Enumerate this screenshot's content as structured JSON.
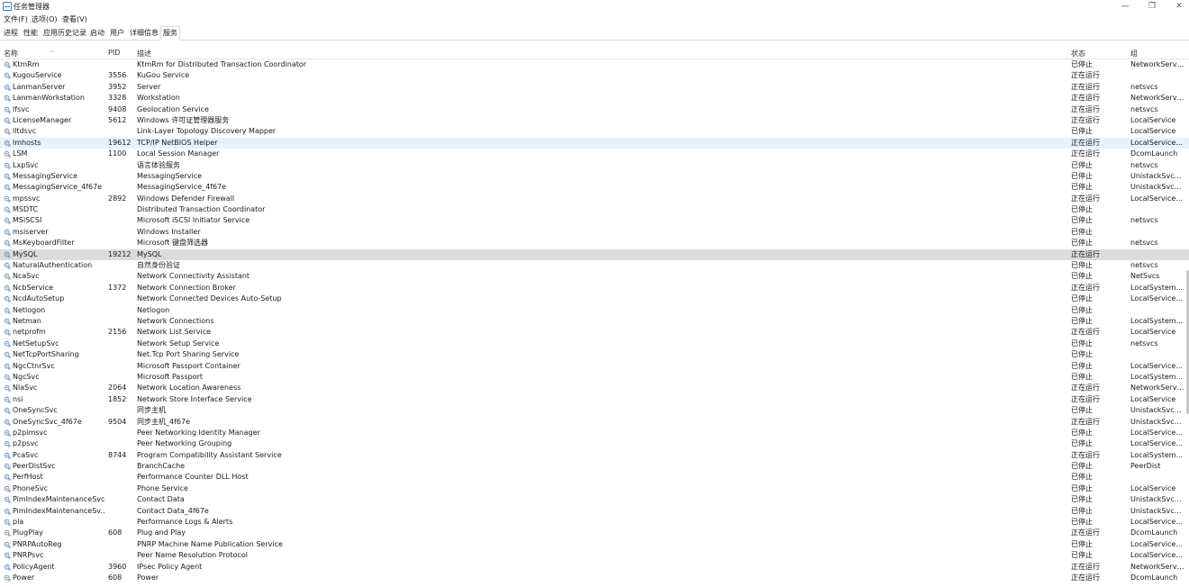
{
  "window": {
    "title": "任务管理器",
    "minimize": "—",
    "restore": "❐",
    "close": "✕"
  },
  "menu": [
    {
      "label": "文件(F)"
    },
    {
      "label": "选项(O)"
    },
    {
      "label": "查看(V)"
    }
  ],
  "tabs": [
    {
      "label": "进程"
    },
    {
      "label": "性能"
    },
    {
      "label": "应用历史记录"
    },
    {
      "label": "启动"
    },
    {
      "label": "用户"
    },
    {
      "label": "详细信息"
    },
    {
      "label": "服务",
      "active": true
    }
  ],
  "columns": {
    "name": "名称",
    "pid": "PID",
    "desc": "描述",
    "status": "状态",
    "group": "组"
  },
  "icons": {
    "service": "gear-service-icon",
    "sort": "sort-up-icon"
  },
  "colors": {
    "selected_row": "#cfe7fb",
    "hover_row": "#dcdcdc"
  },
  "rows": [
    {
      "name": "KtmRm",
      "pid": "",
      "desc": "KtmRm for Distributed Transaction Coordinator",
      "status": "已停止",
      "group": "NetworkServi..."
    },
    {
      "name": "KugouService",
      "pid": "3556",
      "desc": "KuGou Service",
      "status": "正在运行",
      "group": ""
    },
    {
      "name": "LanmanServer",
      "pid": "3952",
      "desc": "Server",
      "status": "正在运行",
      "group": "netsvcs"
    },
    {
      "name": "LanmanWorkstation",
      "pid": "3328",
      "desc": "Workstation",
      "status": "正在运行",
      "group": "NetworkServi..."
    },
    {
      "name": "lfsvc",
      "pid": "9408",
      "desc": "Geolocation Service",
      "status": "正在运行",
      "group": "netsvcs"
    },
    {
      "name": "LicenseManager",
      "pid": "5612",
      "desc": "Windows 许可证管理器服务",
      "status": "正在运行",
      "group": "LocalService"
    },
    {
      "name": "lltdsvc",
      "pid": "",
      "desc": "Link-Layer Topology Discovery Mapper",
      "status": "已停止",
      "group": "LocalService"
    },
    {
      "name": "lmhosts",
      "pid": "19612",
      "desc": "TCP/IP NetBIOS Helper",
      "status": "正在运行",
      "group": "LocalService...",
      "state": "highlight"
    },
    {
      "name": "LSM",
      "pid": "1100",
      "desc": "Local Session Manager",
      "status": "正在运行",
      "group": "DcomLaunch"
    },
    {
      "name": "LxpSvc",
      "pid": "",
      "desc": "语言体验服务",
      "status": "已停止",
      "group": "netsvcs"
    },
    {
      "name": "MessagingService",
      "pid": "",
      "desc": "MessagingService",
      "status": "已停止",
      "group": "UnistackSvcG..."
    },
    {
      "name": "MessagingService_4f67e",
      "pid": "",
      "desc": "MessagingService_4f67e",
      "status": "已停止",
      "group": "UnistackSvcG..."
    },
    {
      "name": "mpssvc",
      "pid": "2892",
      "desc": "Windows Defender Firewall",
      "status": "正在运行",
      "group": "LocalService..."
    },
    {
      "name": "MSDTC",
      "pid": "",
      "desc": "Distributed Transaction Coordinator",
      "status": "已停止",
      "group": ""
    },
    {
      "name": "MSiSCSI",
      "pid": "",
      "desc": "Microsoft iSCSI Initiator Service",
      "status": "已停止",
      "group": "netsvcs"
    },
    {
      "name": "msiserver",
      "pid": "",
      "desc": "Windows Installer",
      "status": "已停止",
      "group": ""
    },
    {
      "name": "MsKeyboardFilter",
      "pid": "",
      "desc": "Microsoft 键盘筛选器",
      "status": "已停止",
      "group": "netsvcs"
    },
    {
      "name": "MySQL",
      "pid": "19212",
      "desc": "MySQL",
      "status": "正在运行",
      "group": "",
      "state": "hover"
    },
    {
      "name": "NaturalAuthentication",
      "pid": "",
      "desc": "自然身份验证",
      "status": "已停止",
      "group": "netsvcs"
    },
    {
      "name": "NcaSvc",
      "pid": "",
      "desc": "Network Connectivity Assistant",
      "status": "已停止",
      "group": "NetSvcs"
    },
    {
      "name": "NcbService",
      "pid": "1372",
      "desc": "Network Connection Broker",
      "status": "正在运行",
      "group": "LocalSystem..."
    },
    {
      "name": "NcdAutoSetup",
      "pid": "",
      "desc": "Network Connected Devices Auto-Setup",
      "status": "已停止",
      "group": "LocalService..."
    },
    {
      "name": "Netlogon",
      "pid": "",
      "desc": "Netlogon",
      "status": "已停止",
      "group": ""
    },
    {
      "name": "Netman",
      "pid": "",
      "desc": "Network Connections",
      "status": "已停止",
      "group": "LocalSystem..."
    },
    {
      "name": "netprofm",
      "pid": "2156",
      "desc": "Network List Service",
      "status": "正在运行",
      "group": "LocalService"
    },
    {
      "name": "NetSetupSvc",
      "pid": "",
      "desc": "Network Setup Service",
      "status": "已停止",
      "group": "netsvcs"
    },
    {
      "name": "NetTcpPortSharing",
      "pid": "",
      "desc": "Net.Tcp Port Sharing Service",
      "status": "已停止",
      "group": ""
    },
    {
      "name": "NgcCtnrSvc",
      "pid": "",
      "desc": "Microsoft Passport Container",
      "status": "已停止",
      "group": "LocalService..."
    },
    {
      "name": "NgcSvc",
      "pid": "",
      "desc": "Microsoft Passport",
      "status": "已停止",
      "group": "LocalSystem..."
    },
    {
      "name": "NlaSvc",
      "pid": "2064",
      "desc": "Network Location Awareness",
      "status": "正在运行",
      "group": "NetworkServi..."
    },
    {
      "name": "nsi",
      "pid": "1852",
      "desc": "Network Store Interface Service",
      "status": "正在运行",
      "group": "LocalService"
    },
    {
      "name": "OneSyncSvc",
      "pid": "",
      "desc": "同步主机",
      "status": "已停止",
      "group": "UnistackSvcG..."
    },
    {
      "name": "OneSyncSvc_4f67e",
      "pid": "9504",
      "desc": "同步主机_4f67e",
      "status": "正在运行",
      "group": "UnistackSvcG..."
    },
    {
      "name": "p2pimsvc",
      "pid": "",
      "desc": "Peer Networking Identity Manager",
      "status": "已停止",
      "group": "LocalService..."
    },
    {
      "name": "p2psvc",
      "pid": "",
      "desc": "Peer Networking Grouping",
      "status": "已停止",
      "group": "LocalService..."
    },
    {
      "name": "PcaSvc",
      "pid": "8744",
      "desc": "Program Compatibility Assistant Service",
      "status": "正在运行",
      "group": "LocalSystem..."
    },
    {
      "name": "PeerDistSvc",
      "pid": "",
      "desc": "BranchCache",
      "status": "已停止",
      "group": "PeerDist"
    },
    {
      "name": "PerfHost",
      "pid": "",
      "desc": "Performance Counter DLL Host",
      "status": "已停止",
      "group": ""
    },
    {
      "name": "PhoneSvc",
      "pid": "",
      "desc": "Phone Service",
      "status": "已停止",
      "group": "LocalService"
    },
    {
      "name": "PimIndexMaintenanceSvc",
      "pid": "",
      "desc": "Contact Data",
      "status": "已停止",
      "group": "UnistackSvcG..."
    },
    {
      "name": "PimIndexMaintenanceSv...",
      "pid": "",
      "desc": "Contact Data_4f67e",
      "status": "已停止",
      "group": "UnistackSvcG..."
    },
    {
      "name": "pla",
      "pid": "",
      "desc": "Performance Logs & Alerts",
      "status": "已停止",
      "group": "LocalService..."
    },
    {
      "name": "PlugPlay",
      "pid": "608",
      "desc": "Plug and Play",
      "status": "正在运行",
      "group": "DcomLaunch"
    },
    {
      "name": "PNRPAutoReg",
      "pid": "",
      "desc": "PNRP Machine Name Publication Service",
      "status": "已停止",
      "group": "LocalService..."
    },
    {
      "name": "PNRPsvc",
      "pid": "",
      "desc": "Peer Name Resolution Protocol",
      "status": "已停止",
      "group": "LocalService..."
    },
    {
      "name": "PolicyAgent",
      "pid": "3960",
      "desc": "IPsec Policy Agent",
      "status": "正在运行",
      "group": "NetworkServi..."
    },
    {
      "name": "Power",
      "pid": "608",
      "desc": "Power",
      "status": "正在运行",
      "group": "DcomLaunch"
    }
  ]
}
